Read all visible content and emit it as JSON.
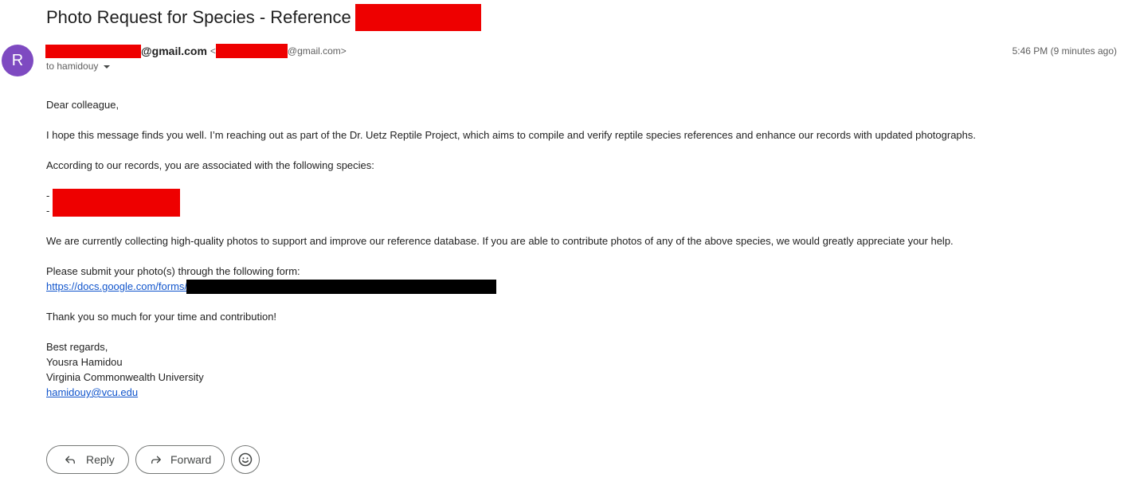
{
  "email": {
    "subject": "Photo Request for Species - Reference",
    "avatar_letter": "R",
    "sender_domain_bold": "@gmail.com",
    "sender_lt": "<",
    "sender_addr_suffix": "@gmail.com>",
    "to_label": "to hamidouy",
    "timestamp": "5:46 PM (9 minutes ago)"
  },
  "body": {
    "greeting": "Dear colleague,",
    "intro": "I hope this message finds you well. I’m reaching out as part of the Dr. Uetz Reptile Project, which aims to compile and verify reptile species references and enhance our records with updated photographs.",
    "records": "According to our records, you are associated with the following species:",
    "species_bullets": [
      "-",
      "-"
    ],
    "collecting": "We are currently collecting high-quality photos to support and improve our reference database. If you are able to contribute photos of any of the above species, we would greatly appreciate your help.",
    "submit": "Please submit your photo(s) through the following form:",
    "form_link": "https://docs.google.com/forms/",
    "thanks": "Thank you so much for your time and contribution!",
    "signoff": "Best regards,",
    "sig_name": "Yousra Hamidou",
    "sig_org": "Virginia Commonwealth University",
    "sig_email": "hamidouy@vcu.edu"
  },
  "actions": {
    "reply_label": "Reply",
    "forward_label": "Forward"
  },
  "icons": {
    "reply": "reply-icon",
    "forward": "forward-icon",
    "emoji": "emoji-icon",
    "caret": "chevron-down-icon"
  },
  "colors": {
    "avatar": "#7e4ac1",
    "redaction_red": "#ee0000",
    "redaction_black": "#000000",
    "link": "#1155cc"
  }
}
